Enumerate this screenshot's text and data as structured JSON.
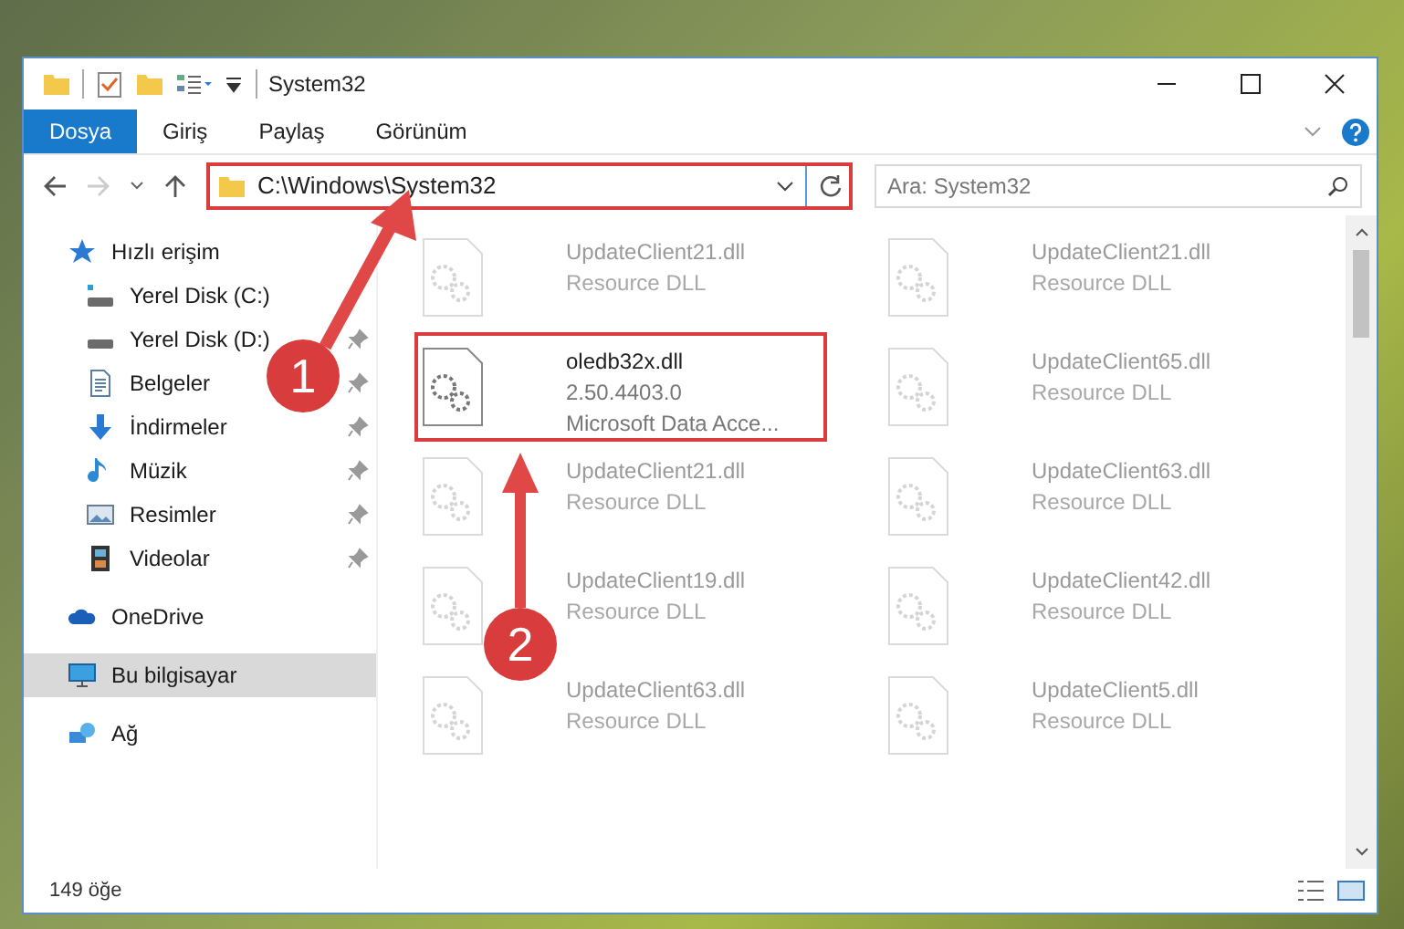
{
  "window": {
    "title": "System32"
  },
  "ribbon_tabs": [
    {
      "label": "Dosya",
      "selected": true
    },
    {
      "label": "Giriş",
      "selected": false
    },
    {
      "label": "Paylaş",
      "selected": false
    },
    {
      "label": "Görünüm",
      "selected": false
    }
  ],
  "address_bar": {
    "value": "C:\\Windows\\System32",
    "highlighted": true
  },
  "search": {
    "placeholder": "Ara: System32"
  },
  "sidebar": {
    "items": [
      {
        "label": "Hızlı erişim",
        "kind": "quick",
        "selected": false,
        "children": [
          {
            "label": "Yerel Disk (C:)",
            "kind": "system-drive",
            "pinned": false
          },
          {
            "label": "Yerel Disk (D:)",
            "kind": "drive",
            "pinned": true
          },
          {
            "label": "Belgeler",
            "kind": "documents",
            "pinned": true
          },
          {
            "label": "İndirmeler",
            "kind": "downloads",
            "pinned": true
          },
          {
            "label": "Müzik",
            "kind": "music",
            "pinned": true
          },
          {
            "label": "Resimler",
            "kind": "pictures",
            "pinned": true
          },
          {
            "label": "Videolar",
            "kind": "videos",
            "pinned": true
          }
        ]
      },
      {
        "label": "OneDrive",
        "kind": "cloud",
        "selected": false
      },
      {
        "label": "Bu bilgisayar",
        "kind": "computer",
        "selected": true
      },
      {
        "label": "Ağ",
        "kind": "network",
        "selected": false
      }
    ]
  },
  "files": [
    {
      "name": "UpdateClient21.dll",
      "details": [
        "Resource DLL"
      ],
      "faded": true,
      "highlighted": false
    },
    {
      "name": "UpdateClient21.dll",
      "details": [
        "Resource DLL"
      ],
      "faded": true,
      "highlighted": false
    },
    {
      "name": "oledb32x.dll",
      "details": [
        "2.50.4403.0",
        "Microsoft Data Acce..."
      ],
      "faded": false,
      "highlighted": true
    },
    {
      "name": "UpdateClient65.dll",
      "details": [
        "Resource DLL"
      ],
      "faded": true,
      "highlighted": false
    },
    {
      "name": "UpdateClient21.dll",
      "details": [
        "Resource DLL"
      ],
      "faded": true,
      "highlighted": false
    },
    {
      "name": "UpdateClient63.dll",
      "details": [
        "Resource DLL"
      ],
      "faded": true,
      "highlighted": false
    },
    {
      "name": "UpdateClient19.dll",
      "details": [
        "Resource DLL"
      ],
      "faded": true,
      "highlighted": false
    },
    {
      "name": "UpdateClient42.dll",
      "details": [
        "Resource DLL"
      ],
      "faded": true,
      "highlighted": false
    },
    {
      "name": "UpdateClient63.dll",
      "details": [
        "Resource DLL"
      ],
      "faded": true,
      "highlighted": false
    },
    {
      "name": "UpdateClient5.dll",
      "details": [
        "Resource DLL"
      ],
      "faded": true,
      "highlighted": false
    }
  ],
  "status_bar": {
    "count": "149 öğe"
  },
  "callouts": [
    {
      "label": "1"
    },
    {
      "label": "2"
    }
  ]
}
